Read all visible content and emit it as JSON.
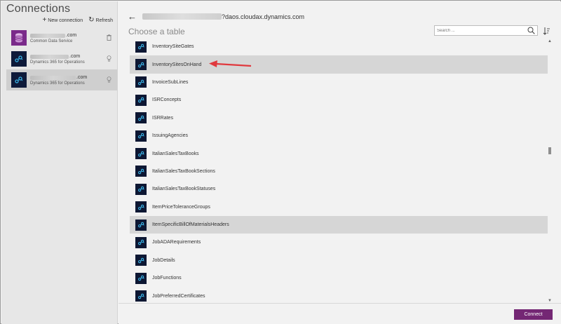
{
  "left_panel": {
    "title": "Connections",
    "new_connection_label": "New connection",
    "refresh_label": "Refresh",
    "connections": [
      {
        "name_suffix": ".com",
        "type": "Common Data Service",
        "icon": "database-icon",
        "status_icon": "trash-icon",
        "selected": false
      },
      {
        "name_suffix": ".com",
        "type": "Dynamics 365 for Operations",
        "icon": "dynamics-icon",
        "status_icon": "lightbulb-icon",
        "selected": false
      },
      {
        "name_suffix": ".com",
        "type": "Dynamics 365 for Operations",
        "icon": "dynamics-icon",
        "status_icon": "lightbulb-icon",
        "selected": true
      }
    ]
  },
  "header": {
    "url_suffix": "?daos.cloudax.dynamics.com",
    "choose_label": "Choose a table",
    "search_placeholder": "Search ..."
  },
  "tables": [
    {
      "label": "InventorySiteGates",
      "highlighted": false
    },
    {
      "label": "InventorySitesOnHand",
      "highlighted": true
    },
    {
      "label": "InvoiceSubLines",
      "highlighted": false
    },
    {
      "label": "ISRConcepts",
      "highlighted": false
    },
    {
      "label": "ISRRates",
      "highlighted": false
    },
    {
      "label": "IssuingAgencies",
      "highlighted": false
    },
    {
      "label": "ItalianSalesTaxBooks",
      "highlighted": false
    },
    {
      "label": "ItalianSalesTaxBookSections",
      "highlighted": false
    },
    {
      "label": "ItalianSalesTaxBookStatuses",
      "highlighted": false
    },
    {
      "label": "ItemPriceToleranceGroups",
      "highlighted": false
    },
    {
      "label": "ItemSpecificBillOfMaterialsHeaders",
      "highlighted": true
    },
    {
      "label": "JobADARequirements",
      "highlighted": false
    },
    {
      "label": "JobDetails",
      "highlighted": false
    },
    {
      "label": "JobFunctions",
      "highlighted": false
    },
    {
      "label": "JobPreferredCertificates",
      "highlighted": false
    }
  ],
  "footer": {
    "connect_label": "Connect"
  },
  "colors": {
    "accent": "#742774",
    "arrow": "#e0393e",
    "cds_icon": "#7a2a8a",
    "d365_icon": "#0e1a3a"
  }
}
